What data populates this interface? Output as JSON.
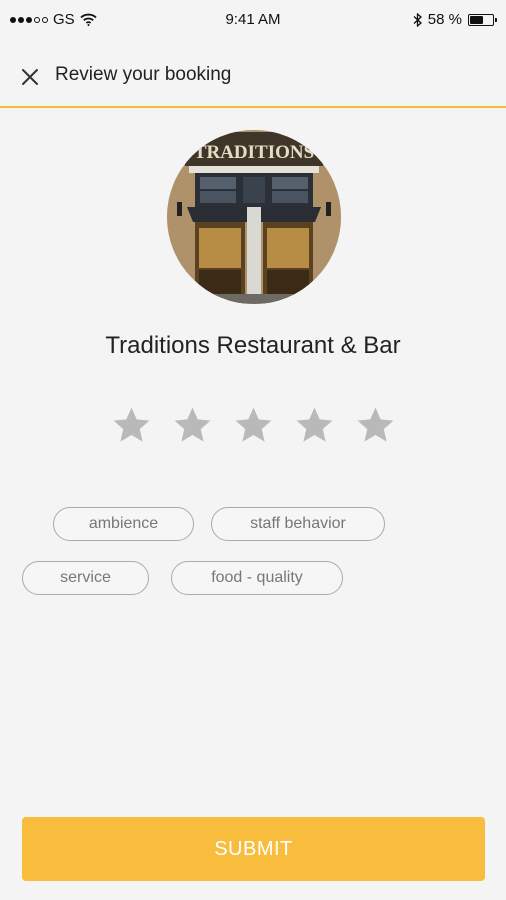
{
  "status_bar": {
    "carrier": "GS",
    "time": "9:41 AM",
    "battery": "58 %",
    "battery_level": 0.58
  },
  "header": {
    "title": "Review your booking",
    "close_icon": "close-icon"
  },
  "restaurant": {
    "name": "Traditions Restaurant & Bar",
    "sign_text": "TRADITIONS"
  },
  "rating": {
    "max": 5,
    "value": 0,
    "star_color": "#b9b9b9"
  },
  "tags": [
    "ambience",
    "staff behavior",
    "service",
    "food - quality"
  ],
  "submit_label": "SUBMIT",
  "colors": {
    "accent": "#f8bd3d",
    "header_border": "#f7bb3a",
    "tag_border": "#aaaaaa",
    "tag_text": "#777777"
  }
}
